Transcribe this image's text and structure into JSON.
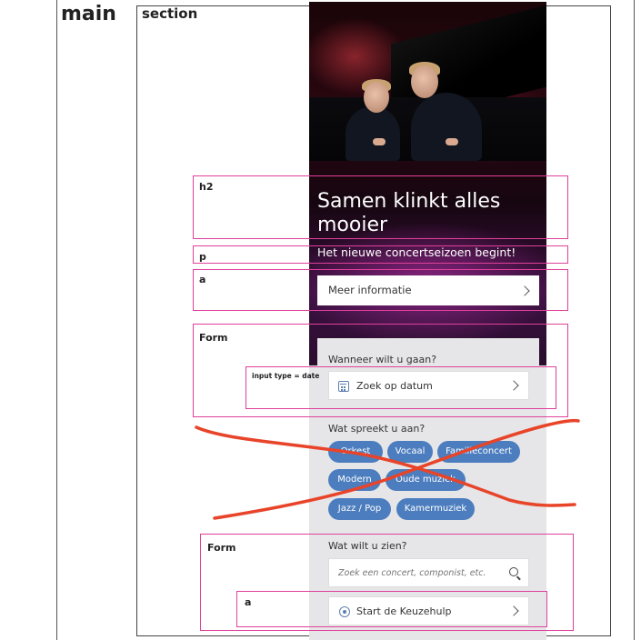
{
  "overlay": {
    "main_label": "main",
    "section_label": "section",
    "h2_label": "h2",
    "p_label": "p",
    "a_label": "a",
    "form_label": "Form",
    "input_label": "input type = date",
    "form2_label": "Form",
    "a2_label": "a",
    "box_color": "#e0409a",
    "scribble_color": "#e8442a"
  },
  "hero": {
    "title": "Samen klinkt alles mooier",
    "subtitle": "Het nieuwe concertseizoen begint!",
    "button_label": "Meer informatie"
  },
  "date_section": {
    "question": "Wanneer wilt u gaan?",
    "button_label": "Zoek op datum"
  },
  "genre_section": {
    "question": "Wat spreekt u aan?",
    "chips": [
      "Orkest",
      "Vocaal",
      "Familieconcert",
      "Modern",
      "Oude muziek",
      "Jazz / Pop",
      "Kamermuziek"
    ],
    "chip_color": "#4c7dbf"
  },
  "search_section": {
    "question": "Wat wilt u zien?",
    "placeholder": "Zoek een concert, componist, etc.",
    "button_label": "Start de Keuzehulp"
  }
}
